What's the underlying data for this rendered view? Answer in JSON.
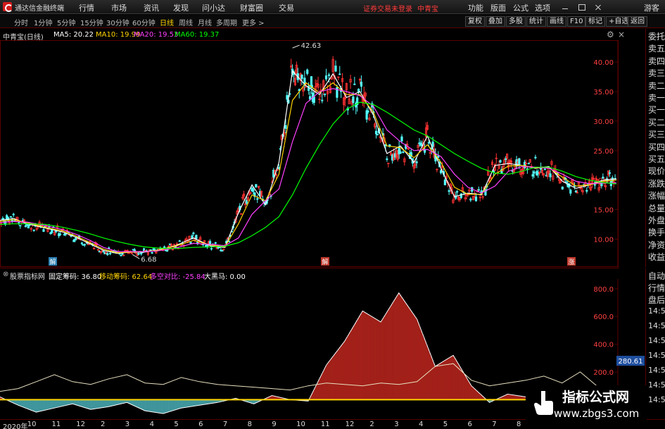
{
  "titlebar": {
    "app_title": "通达信金融终端",
    "menus": [
      "行情",
      "市场",
      "资讯",
      "发现",
      "问小达",
      "财富圈",
      "交易"
    ],
    "login_status": "证券交易未登录",
    "current_stock": "中青宝",
    "right_menus": [
      "功能",
      "版面",
      "公式",
      "选项"
    ],
    "user_label": "游客"
  },
  "periodbar": {
    "periods": [
      "分时",
      "1分钟",
      "5分钟",
      "15分钟",
      "30分钟",
      "60分钟",
      "日线",
      "周线",
      "月线",
      "多周期",
      "更多 >"
    ],
    "active_period": "日线",
    "tools": [
      "复权",
      "叠加",
      "多股",
      "统计",
      "画线",
      "F10",
      "标记",
      "+自选",
      "返回"
    ]
  },
  "chart_header": {
    "stock_label": "中青宝(日线)",
    "ma5": "MA5: 20.22",
    "ma10": "MA10: 19.99",
    "ma20": "MA20: 19.53",
    "ma60": "MA60: 19.37"
  },
  "colors": {
    "ma5": "#ffffff",
    "ma10": "#ffd400",
    "ma20": "#ff40ff",
    "ma60": "#00ff00",
    "up": "#ff3232",
    "down": "#54ffff",
    "grid": "#5a0000"
  },
  "right_panel": {
    "items": [
      "委托",
      "卖五",
      "卖四",
      "卖三",
      "卖二",
      "卖一",
      "买一",
      "买二",
      "买三",
      "买四",
      "买五",
      "现价",
      "涨跌",
      "涨幅",
      "总量",
      "外盘",
      "换手",
      "净资",
      "收益"
    ],
    "items2": [
      "自动",
      "行情",
      "盘后"
    ],
    "times": [
      "14:5",
      "14:5",
      "14:5",
      "14:5",
      "14:5",
      "14:5",
      "14:5"
    ]
  },
  "indicator_header": {
    "name": "股票指标网",
    "fixed": "固定筹码: 36.80",
    "moving": "移动筹码: 62.64",
    "longshort": "多空对比: -25.84",
    "darkhorse": "大黑马: 0.00"
  },
  "chart_data": [
    {
      "type": "line",
      "title": "中青宝(日线)",
      "ylim": [
        6,
        43
      ],
      "y_ticks": [
        "40.00",
        "35.00",
        "30.00",
        "25.00",
        "20.00",
        "15.00",
        "10.00"
      ],
      "annotations": [
        "42.63",
        "6.68"
      ],
      "markers": [
        "解",
        "解",
        "涨"
      ],
      "x": [
        0,
        6,
        12,
        20,
        28,
        34,
        40,
        46,
        52,
        58,
        64,
        70,
        78,
        86,
        94,
        100,
        106,
        112,
        118,
        124,
        130,
        136,
        142,
        148,
        154,
        160,
        166,
        172,
        178,
        184,
        190,
        196,
        202,
        208,
        214,
        220,
        226,
        232,
        238,
        244,
        250,
        256,
        262,
        268,
        274
      ],
      "series": [
        {
          "values": [
            13.2,
            13.5,
            12.6,
            11.9,
            11.2,
            10.3,
            9.2,
            8.1,
            7.6,
            7.8,
            7.8,
            8.1,
            8.9,
            10.2,
            8.8,
            8.6,
            14.5,
            19.2,
            15.8,
            23.0,
            38.5,
            36.0,
            34.5,
            38.0,
            34.0,
            35.0,
            31.0,
            24.5,
            25.8,
            23.0,
            27.5,
            22.0,
            17.2,
            17.8,
            17.5,
            22.5,
            22.8,
            22.5,
            22.0,
            22.3,
            19.8,
            18.6,
            19.2,
            20.0,
            20.2
          ]
        },
        {
          "values": [
            13.0,
            13.3,
            12.8,
            12.0,
            11.4,
            10.5,
            9.4,
            8.3,
            7.7,
            7.8,
            7.9,
            8.1,
            8.8,
            9.8,
            9.0,
            8.7,
            12.6,
            17.5,
            16.5,
            21.0,
            33.5,
            36.5,
            34.8,
            36.5,
            34.5,
            34.5,
            31.5,
            25.8,
            25.5,
            23.8,
            26.0,
            23.0,
            18.8,
            17.6,
            17.6,
            21.0,
            22.4,
            22.5,
            22.1,
            22.1,
            20.5,
            19.0,
            19.2,
            19.8,
            19.99
          ]
        },
        {
          "values": [
            12.8,
            13.0,
            12.9,
            12.3,
            11.6,
            10.8,
            9.8,
            8.6,
            7.9,
            7.9,
            7.9,
            8.0,
            8.5,
            9.3,
            9.1,
            8.9,
            10.2,
            14.2,
            16.5,
            18.5,
            26.5,
            33.0,
            35.0,
            35.5,
            35.0,
            34.3,
            32.5,
            28.5,
            26.5,
            25.0,
            25.2,
            24.0,
            21.0,
            18.8,
            17.8,
            19.0,
            21.5,
            22.3,
            22.2,
            22.0,
            21.0,
            19.8,
            19.4,
            19.5,
            19.53
          ]
        },
        {
          "values": [
            12.5,
            12.6,
            12.6,
            12.5,
            12.0,
            11.5,
            10.9,
            10.2,
            9.6,
            9.1,
            8.7,
            8.5,
            8.4,
            8.6,
            8.7,
            8.8,
            9.4,
            10.6,
            12.0,
            13.8,
            17.5,
            22.0,
            26.0,
            29.5,
            32.0,
            33.2,
            32.8,
            31.5,
            30.0,
            28.5,
            27.5,
            26.0,
            24.5,
            23.2,
            22.0,
            21.2,
            21.0,
            21.5,
            22.2,
            22.2,
            21.5,
            20.6,
            20.0,
            19.6,
            19.37
          ]
        }
      ]
    },
    {
      "type": "area",
      "ylim": [
        -120,
        850
      ],
      "y_ticks": [
        "800.0",
        "600.0",
        "400.0",
        "200.0"
      ],
      "current_value_label": "280.61",
      "x": [
        0,
        8,
        16,
        24,
        32,
        40,
        48,
        56,
        64,
        72,
        80,
        88,
        96,
        104,
        112,
        120,
        128,
        136,
        144,
        152,
        160,
        168,
        176,
        184,
        192,
        200,
        208,
        216,
        224,
        232,
        240,
        248,
        256,
        264,
        272
      ],
      "series": [
        {
          "name": "移动筹码",
          "values": [
            20,
            -40,
            -90,
            -60,
            -30,
            -70,
            -50,
            -20,
            -80,
            -100,
            -60,
            -40,
            -20,
            10,
            -30,
            30,
            0,
            -10,
            250,
            420,
            640,
            560,
            770,
            580,
            240,
            320,
            100,
            -20,
            40,
            20,
            -10,
            10,
            20,
            30,
            20
          ]
        },
        {
          "name": "固定筹码",
          "values": [
            60,
            80,
            130,
            180,
            130,
            110,
            150,
            180,
            120,
            110,
            160,
            130,
            110,
            100,
            90,
            80,
            70,
            100,
            120,
            110,
            100,
            120,
            110,
            130,
            240,
            260,
            140,
            100,
            120,
            140,
            170,
            120,
            200,
            90,
            100
          ]
        }
      ]
    }
  ],
  "date_axis": [
    "2020年",
    "10",
    "11",
    "12",
    "2",
    "3",
    "4",
    "5",
    "6",
    "7",
    "8",
    "9",
    "10",
    "11",
    "12",
    "2",
    "3",
    "4",
    "5",
    "6",
    "7",
    "8"
  ],
  "watermark": {
    "title": "指标公式网",
    "url": "www.zbgs3.com"
  }
}
